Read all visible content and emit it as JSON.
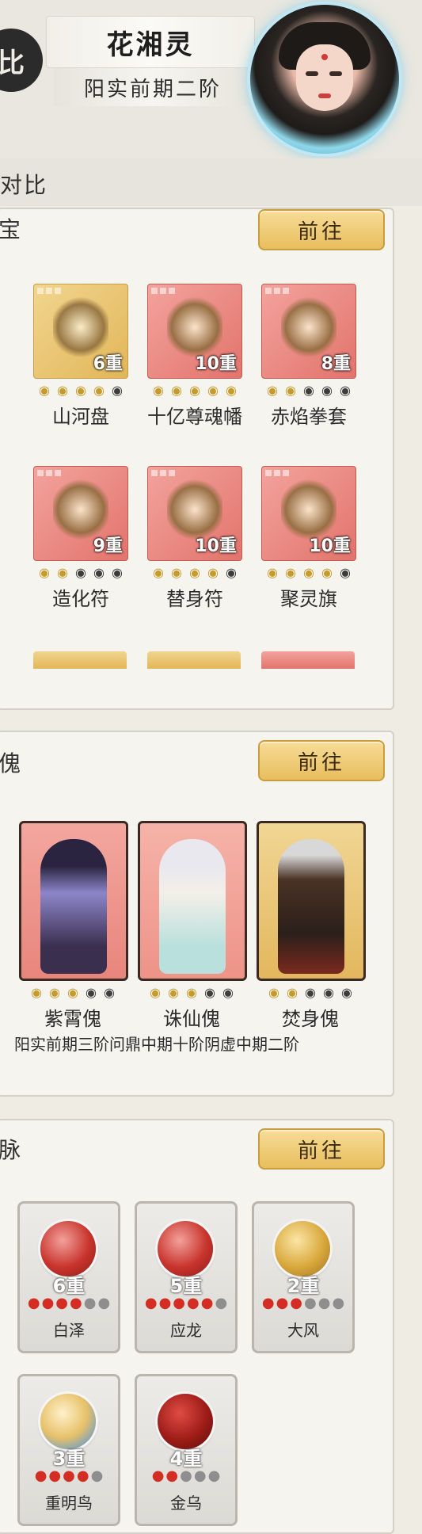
{
  "header": {
    "emblem": "比",
    "character_name": "花湘灵",
    "realm": "阳实前期二阶"
  },
  "section_title": "对比",
  "treasure_panel": {
    "title": "宝",
    "goto_label": "前往",
    "items": [
      {
        "name": "山河盘",
        "tier": "6重",
        "stars_on": 4,
        "stars_total": 5,
        "rarity": "gold"
      },
      {
        "name": "十亿尊魂幡",
        "tier": "10重",
        "stars_on": 5,
        "stars_total": 5,
        "rarity": "red"
      },
      {
        "name": "赤焰拳套",
        "tier": "8重",
        "stars_on": 2,
        "stars_total": 5,
        "rarity": "red"
      },
      {
        "name": "造化符",
        "tier": "9重",
        "stars_on": 2,
        "stars_total": 5,
        "rarity": "red"
      },
      {
        "name": "替身符",
        "tier": "10重",
        "stars_on": 4,
        "stars_total": 5,
        "rarity": "red"
      },
      {
        "name": "聚灵旗",
        "tier": "10重",
        "stars_on": 4,
        "stars_total": 5,
        "rarity": "red"
      }
    ]
  },
  "puppet_panel": {
    "title": "傀",
    "goto_label": "前往",
    "items": [
      {
        "name": "紫霄傀",
        "stars_on": 3,
        "stars_total": 5
      },
      {
        "name": "诛仙傀",
        "stars_on": 3,
        "stars_total": 5
      },
      {
        "name": "焚身傀",
        "stars_on": 2,
        "stars_total": 5
      }
    ],
    "realms_line": "阳实前期三阶问鼎中期十阶阴虚中期二阶"
  },
  "vein_panel": {
    "title": "脉",
    "goto_label": "前往",
    "items": [
      {
        "name": "白泽",
        "tier": "6重",
        "drops_on": 4,
        "drops_total": 6
      },
      {
        "name": "应龙",
        "tier": "5重",
        "drops_on": 5,
        "drops_total": 6
      },
      {
        "name": "大风",
        "tier": "2重",
        "drops_on": 3,
        "drops_total": 6
      },
      {
        "name": "重明鸟",
        "tier": "3重",
        "drops_on": 4,
        "drops_total": 5
      },
      {
        "name": "金乌",
        "tier": "4重",
        "drops_on": 2,
        "drops_total": 5
      }
    ]
  }
}
